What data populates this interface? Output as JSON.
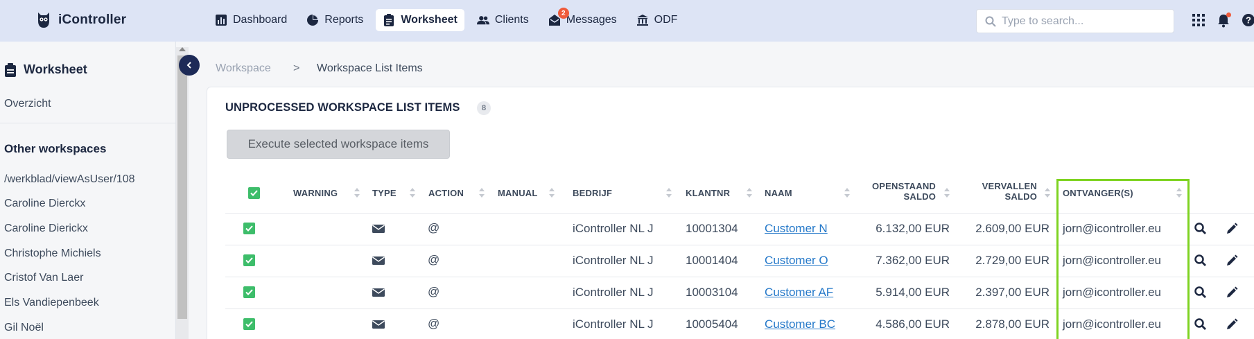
{
  "app": {
    "name": "iController"
  },
  "nav": [
    {
      "label": "Dashboard",
      "icon": "chart-icon",
      "active": false
    },
    {
      "label": "Reports",
      "icon": "pie-chart-icon",
      "active": false
    },
    {
      "label": "Worksheet",
      "icon": "clipboard-icon",
      "active": true
    },
    {
      "label": "Clients",
      "icon": "users-icon",
      "active": false
    },
    {
      "label": "Messages",
      "icon": "envelope-icon",
      "active": false,
      "badge": "2"
    },
    {
      "label": "ODF",
      "icon": "bank-icon",
      "active": false
    }
  ],
  "search": {
    "placeholder": "Type to search..."
  },
  "sidebar": {
    "title": "Worksheet",
    "overview": "Overzicht",
    "other_heading": "Other workspaces",
    "items": [
      "/werkblad/viewAsUser/108",
      "Caroline Dierckx",
      "Caroline Dierickx",
      "Christophe Michiels",
      "Cristof Van Laer",
      "Els Vandiepenbeek",
      "Gil Noël"
    ]
  },
  "breadcrumb": {
    "root": "Workspace",
    "separator": ">",
    "current": "Workspace List Items"
  },
  "panel": {
    "title": "UNPROCESSED WORKSPACE LIST ITEMS",
    "count": "8",
    "execute_label": "Execute selected workspace items"
  },
  "table": {
    "columns": {
      "warning": "WARNING",
      "type": "TYPE",
      "action": "ACTION",
      "manual": "MANUAL",
      "bedrijf": "BEDRIJF",
      "klantnr": "KLANTNR",
      "naam": "NAAM",
      "openstaand_1": "OPENSTAAND",
      "openstaand_2": "SALDO",
      "vervallen_1": "VERVALLEN",
      "vervallen_2": "SALDO",
      "ontvangers": "ONTVANGER(S)"
    },
    "rows": [
      {
        "action": "@",
        "bedrijf": "iController NL J",
        "klantnr": "10001304",
        "naam": "Customer N",
        "openstaand": "6.132,00 EUR",
        "vervallen": "2.609,00 EUR",
        "ontvanger": "jorn@icontroller.eu"
      },
      {
        "action": "@",
        "bedrijf": "iController NL J",
        "klantnr": "10001404",
        "naam": "Customer O",
        "openstaand": "7.362,00 EUR",
        "vervallen": "2.729,00 EUR",
        "ontvanger": "jorn@icontroller.eu"
      },
      {
        "action": "@",
        "bedrijf": "iController NL J",
        "klantnr": "10003104",
        "naam": "Customer AF",
        "openstaand": "5.914,00 EUR",
        "vervallen": "2.397,00 EUR",
        "ontvanger": "jorn@icontroller.eu"
      },
      {
        "action": "@",
        "bedrijf": "iController NL J",
        "klantnr": "10005404",
        "naam": "Customer BC",
        "openstaand": "4.586,00 EUR",
        "vervallen": "2.878,00 EUR",
        "ontvanger": "jorn@icontroller.eu"
      }
    ]
  },
  "colors": {
    "topbar": "#dde4f5",
    "check": "#3dbd6a",
    "link": "#2478c9",
    "highlight": "#7ed321",
    "badge": "#ef5b3b"
  }
}
